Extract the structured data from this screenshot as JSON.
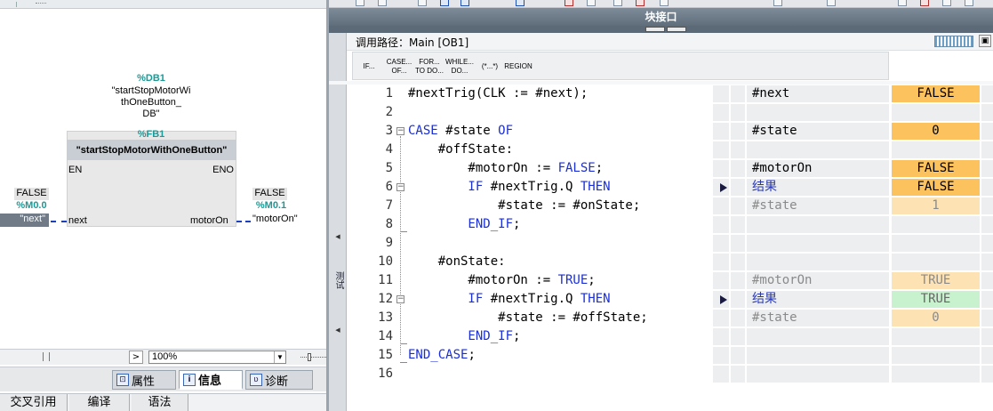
{
  "left_pane": {
    "db_address": "%DB1",
    "db_name_lines": [
      "\"startStopMotorWi",
      "thOneButton_",
      "DB\""
    ],
    "fb_address": "%FB1",
    "fb_title": "\"startStopMotorWithOneButton\"",
    "en_label": "EN",
    "eno_label": "ENO",
    "in_pin_label": "next",
    "out_pin_label": "motorOn",
    "in_value": "FALSE",
    "in_address": "%M0.0",
    "in_tag": "\"next\"",
    "out_value": "FALSE",
    "out_address": "%M0.1",
    "out_tag": "\"motorOn\"",
    "zoom": "100%",
    "inspector_tabs": [
      {
        "label": "属性",
        "icon": "properties-icon"
      },
      {
        "label": "信息",
        "icon": "info-icon"
      },
      {
        "label": "诊断",
        "icon": "diagnostics-icon"
      }
    ],
    "bottom_tabs": [
      "交叉引用",
      "编译",
      "语法"
    ]
  },
  "right_pane": {
    "window_title": "块接口",
    "side_label": "测试",
    "callpath_label": "调用路径：Main [OB1]",
    "snippets": [
      {
        "label": "IF..."
      },
      {
        "label": "CASE... OF..."
      },
      {
        "label": "FOR... TO DO..."
      },
      {
        "label": "WHILE... DO..."
      },
      {
        "label": "(*...*)"
      },
      {
        "label": "REGION"
      }
    ],
    "code_lines": [
      {
        "n": "1",
        "text": "#nextTrig(CLK := #next);"
      },
      {
        "n": "2",
        "text": ""
      },
      {
        "n": "3",
        "kw1": "CASE",
        "mid": " #state ",
        "kw2": "OF"
      },
      {
        "n": "4",
        "text": "    #offState:"
      },
      {
        "n": "5",
        "pre": "        #motorOn := ",
        "kw2": "FALSE",
        "post": ";"
      },
      {
        "n": "6",
        "kw1": "        IF",
        "mid": " #nextTrig.Q ",
        "kw2": "THEN"
      },
      {
        "n": "7",
        "text": "            #state := #onState;"
      },
      {
        "n": "8",
        "kw1": "        END_IF",
        "mid": ";"
      },
      {
        "n": "9",
        "text": ""
      },
      {
        "n": "10",
        "text": "    #onState:"
      },
      {
        "n": "11",
        "pre": "        #motorOn := ",
        "kw2": "TRUE",
        "post": ";"
      },
      {
        "n": "12",
        "kw1": "        IF",
        "mid": " #nextTrig.Q ",
        "kw2": "THEN"
      },
      {
        "n": "13",
        "text": "            #state := #offState;"
      },
      {
        "n": "14",
        "kw1": "        END_IF",
        "mid": ";"
      },
      {
        "n": "15",
        "kw1": "END_CASE",
        "mid": ";"
      },
      {
        "n": "16",
        "text": ""
      }
    ],
    "monitor_rows": [
      {
        "name": "#next",
        "value": "FALSE",
        "style": "orange"
      },
      {
        "name": "",
        "value": ""
      },
      {
        "name": "#state",
        "value": "0",
        "style": "orange"
      },
      {
        "name": "",
        "value": ""
      },
      {
        "name": "#motorOn",
        "value": "FALSE",
        "style": "orange"
      },
      {
        "name": "结果",
        "value": "FALSE",
        "style": "orange",
        "arrow": true,
        "name_style": "blue"
      },
      {
        "name": "#state",
        "value": "1",
        "style": "orange-pale",
        "name_style": "gray"
      },
      {
        "name": "",
        "value": ""
      },
      {
        "name": "",
        "value": ""
      },
      {
        "name": "",
        "value": ""
      },
      {
        "name": "#motorOn",
        "value": "TRUE",
        "style": "orange-pale",
        "name_style": "gray"
      },
      {
        "name": "结果",
        "value": "TRUE",
        "style": "green",
        "arrow": true,
        "name_style": "blue"
      },
      {
        "name": "#state",
        "value": "0",
        "style": "orange-pale",
        "name_style": "gray"
      },
      {
        "name": "",
        "value": ""
      },
      {
        "name": "",
        "value": ""
      },
      {
        "name": "",
        "value": ""
      }
    ]
  },
  "colors": {
    "keyword": "#1a2fd8",
    "monitor_true_false": "#fcc25e",
    "monitor_true_green": "#c8f2cd",
    "lad_teal": "#1a9a96",
    "wire": "#1c3fbf"
  }
}
